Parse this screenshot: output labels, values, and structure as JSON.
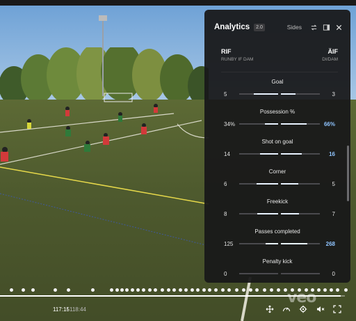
{
  "panel": {
    "title": "Analytics",
    "version": "2.0",
    "sides_label": "Sides",
    "icons": {
      "swap": "swap-icon",
      "layout": "panel-layout-icon",
      "close": "close-icon"
    }
  },
  "teams": {
    "home": {
      "abbr": "RIF",
      "name": "RUNBY IF DAM"
    },
    "away": {
      "abbr": "ÄIF",
      "name": "DI/DAM"
    }
  },
  "stats": [
    {
      "label": "Goal",
      "home": "5",
      "away": "3",
      "home_share": 0.62,
      "away_share": 0.38,
      "lead": "none"
    },
    {
      "label": "Possession %",
      "home": "34%",
      "away": "66%",
      "home_share": 0.34,
      "away_share": 0.66,
      "lead": "away"
    },
    {
      "label": "Shot on goal",
      "home": "14",
      "away": "16",
      "home_share": 0.47,
      "away_share": 0.53,
      "lead": "away"
    },
    {
      "label": "Corner",
      "home": "6",
      "away": "5",
      "home_share": 0.55,
      "away_share": 0.45,
      "lead": "none"
    },
    {
      "label": "Freekick",
      "home": "8",
      "away": "7",
      "home_share": 0.53,
      "away_share": 0.47,
      "lead": "none"
    },
    {
      "label": "Passes completed",
      "home": "125",
      "away": "268",
      "home_share": 0.32,
      "away_share": 0.68,
      "lead": "away"
    },
    {
      "label": "Penalty kick",
      "home": "0",
      "away": "0",
      "home_share": 0,
      "away_share": 0,
      "lead": "none"
    }
  ],
  "player": {
    "time_current": "117:15",
    "time_separator": "/",
    "time_total": "118:44",
    "progress": 0.988,
    "watermark": "veo",
    "controls": [
      "move-icon",
      "speed-icon",
      "settings-icon",
      "mute-icon",
      "fullscreen-icon"
    ]
  },
  "colors": {
    "panel_bg": "#18181a",
    "lead_value": "#8fc4ff",
    "bar_fill": "#e8f2ff"
  }
}
